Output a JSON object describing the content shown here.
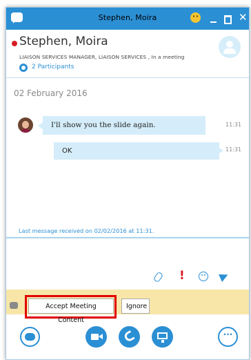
{
  "window": {
    "title": "Stephen, Moira"
  },
  "contact": {
    "name": "Stephen, Moira",
    "subtitle": "LIAISON  SERVICES MANAGER, LIAISON SERVICES , In a meeting",
    "participants": "2 Participants",
    "presence_color": "#d81e23"
  },
  "conversation": {
    "date": "02 February 2016",
    "messages": [
      {
        "text": "I'll show you the slide again.",
        "time": "11:31"
      },
      {
        "text": "OK",
        "time": "11:31"
      }
    ],
    "last_received": "Last message received on 02/02/2016 at 11:31."
  },
  "compose_toolbar": {
    "icons": [
      "attach-icon",
      "important-icon",
      "emoji-icon",
      "send-icon"
    ]
  },
  "notification": {
    "accept_label": "Accept Meeting Content",
    "ignore_label": "Ignore"
  },
  "bottom_toolbar": {
    "icons": [
      "chat-icon",
      "video-icon",
      "call-icon",
      "present-icon",
      "more-icon"
    ],
    "more_glyph": "···"
  },
  "colors": {
    "accent": "#2b8fd4",
    "bubble": "#d5edfa",
    "notification_bar": "#f7e6a8",
    "highlight": "#e00000"
  }
}
